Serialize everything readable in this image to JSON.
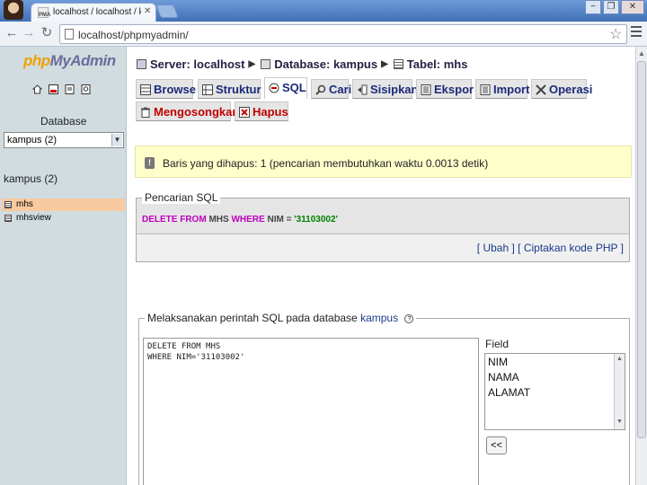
{
  "browser": {
    "tab_title": "localhost / localhost / kampus",
    "tab_favicon_text": "PMA",
    "url": "localhost/phpmyadmin/",
    "window_buttons": [
      "−",
      "❐",
      "✕"
    ]
  },
  "sidebar": {
    "logo_php": "php",
    "logo_my": "MyAdmin",
    "database_label": "Database",
    "selected_database": "kampus (2)",
    "db_heading": "kampus (2)",
    "tables": [
      {
        "label": "mhs",
        "active": true
      },
      {
        "label": "mhsview",
        "active": false
      }
    ]
  },
  "breadcrumb": {
    "server": "Server: localhost",
    "database": "Database: kampus",
    "table": "Tabel: mhs"
  },
  "tabs": [
    {
      "label": "Browse",
      "icon": "browse-icon"
    },
    {
      "label": "Struktur",
      "icon": "structure-icon"
    },
    {
      "label": "SQL",
      "icon": "sql-icon",
      "active": true
    },
    {
      "label": "Cari",
      "icon": "search-icon"
    },
    {
      "label": "Sisipkan",
      "icon": "insert-icon"
    },
    {
      "label": "Ekspor",
      "icon": "export-icon"
    },
    {
      "label": "Import",
      "icon": "import-icon"
    },
    {
      "label": "Operasi",
      "icon": "operations-icon"
    },
    {
      "label": "Mengosongkan",
      "icon": "empty-icon",
      "red": true
    },
    {
      "label": "Hapus",
      "icon": "drop-icon",
      "red": true
    }
  ],
  "notice": {
    "text": "Baris yang dihapus: 1 (pencarian membutuhkan waktu 0.0013 detik)"
  },
  "sql_query_box": {
    "legend": "Pencarian SQL",
    "query_keywords": "DELETE FROM",
    "query_table": "MHS",
    "query_where": "WHERE",
    "query_column": "NIM =",
    "query_value": "'31103002'",
    "edit_link": "Ubah",
    "php_link": "Ciptakan kode PHP"
  },
  "run_sql": {
    "legend_prefix": "Melaksanakan perintah SQL pada database",
    "legend_db": "kampus",
    "textarea_value": "DELETE FROM MHS\nWHERE NIM='31103002'",
    "field_label": "Field",
    "fields": [
      "NIM",
      "NAMA",
      "ALAMAT"
    ],
    "insert_button": "<<"
  },
  "colors": {
    "sidebar_bg": "#d0dce0",
    "active_table": "#f9c9a0",
    "notice_bg": "#ffffcc",
    "link": "#1a3a8a",
    "tab_text": "#1c2a7a",
    "danger_tab": "#c00000"
  }
}
